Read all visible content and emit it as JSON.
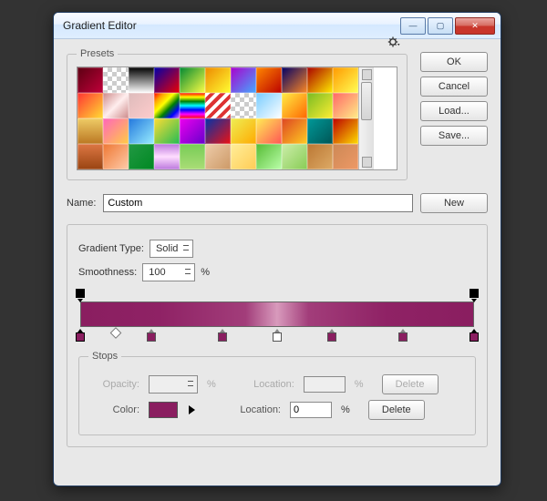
{
  "window": {
    "title": "Gradient Editor"
  },
  "buttons": {
    "ok": "OK",
    "cancel": "Cancel",
    "load": "Load...",
    "save": "Save...",
    "new": "New",
    "delete": "Delete"
  },
  "labels": {
    "presets": "Presets",
    "name": "Name:",
    "gradType": "Gradient Type:",
    "smoothness": "Smoothness:",
    "stops": "Stops",
    "opacity": "Opacity:",
    "color": "Color:",
    "location": "Location:",
    "pct": "%"
  },
  "values": {
    "name": "Custom",
    "gradType": "Solid",
    "smoothness": "100",
    "location2": "0",
    "colorSwatch": "#8a1e60"
  },
  "presets": [
    "linear-gradient(135deg,#5b0012,#c2003a)",
    "repeating-conic-gradient(#ccc 0 25%,#fff 0 50%) 0 0/10px 10px",
    "linear-gradient(#000,#fff)",
    "linear-gradient(135deg,#00a,#e00)",
    "linear-gradient(135deg,#083,#ff4)",
    "linear-gradient(135deg,#e80,#ff3)",
    "linear-gradient(135deg,#a0c,#4af)",
    "linear-gradient(135deg,#f80,#b00)",
    "linear-gradient(135deg,#006,#f82)",
    "linear-gradient(135deg,#a00,#fe0)",
    "linear-gradient(135deg,#f90,#ff5)",
    "linear-gradient(135deg,#f33,#fd3)",
    "linear-gradient(135deg,#c88,#fee,#c88)",
    "linear-gradient(135deg,#dbb,#fcc)",
    "linear-gradient(135deg,red,orange,yellow,green,blue,violet)",
    "linear-gradient(red,yellow,green,cyan,blue,magenta,red)",
    "repeating-linear-gradient(135deg,#fff 0 4px,#d33 4px 8px)",
    "repeating-conic-gradient(#ccc 0 25%,#fff 0 50%) 0 0/10px 10px",
    "linear-gradient(135deg,#7cf,#fff)",
    "linear-gradient(135deg,#fe4,#f60)",
    "linear-gradient(135deg,#7b2,#fe3)",
    "linear-gradient(135deg,#f66,#fe8)",
    "linear-gradient(#ec6,#b72)",
    "linear-gradient(135deg,#f6b,#fc4)",
    "linear-gradient(135deg,#27d,#9ef)",
    "linear-gradient(135deg,#fd3,#2b5)",
    "linear-gradient(135deg,#e0e,#60c)",
    "linear-gradient(135deg,#03a,#e11)",
    "linear-gradient(135deg,#ee5,#fa0)",
    "linear-gradient(135deg,#fe5,#f55)",
    "linear-gradient(135deg,#d42,#fc2)",
    "linear-gradient(135deg,#099,#055)",
    "linear-gradient(135deg,#b00,#fd0)",
    "linear-gradient(#d74,#941)",
    "linear-gradient(135deg,#e73,#fca)",
    "linear-gradient(135deg,#294,#082)",
    "linear-gradient(#b7d,#fdf,#b7d)",
    "linear-gradient(#7c5,#ad7)",
    "linear-gradient(135deg,#eca,#c96)",
    "linear-gradient(135deg,#fe9,#fc5)",
    "linear-gradient(135deg,#5b3,#bfa)",
    "linear-gradient(135deg,#cea,#8c5)",
    "linear-gradient(135deg,#b73,#da6)",
    "linear-gradient(135deg,#c85,#e96)"
  ],
  "opStops": [
    0,
    100
  ],
  "colStops": [
    {
      "p": 0,
      "sel": true
    },
    {
      "p": 18
    },
    {
      "p": 36
    },
    {
      "p": 50,
      "white": true
    },
    {
      "p": 64
    },
    {
      "p": 82
    },
    {
      "p": 100,
      "sel": true
    }
  ],
  "midpoints": [
    9
  ]
}
